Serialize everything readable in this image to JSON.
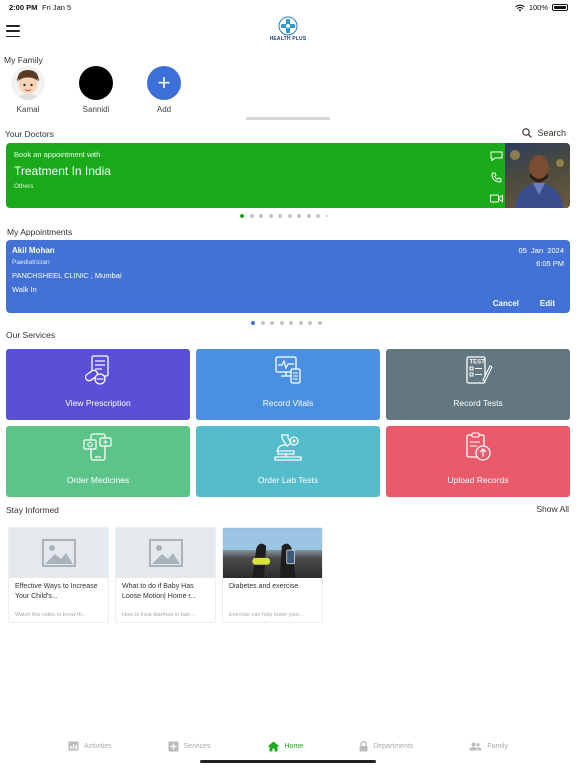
{
  "status_bar": {
    "time": "2:00 PM",
    "date": "Fri Jan 5",
    "battery": "100%"
  },
  "header": {
    "logo_text": "HEALTH PLUS"
  },
  "family": {
    "title": "My Family",
    "members": [
      {
        "name": "Kamal"
      },
      {
        "name": "Sannidi"
      }
    ],
    "add_label": "Add",
    "add_symbol": "+"
  },
  "doctors": {
    "title": "Your Doctors",
    "search_label": "Search",
    "card": {
      "pre": "Book an appointment with",
      "title": "Treatment In India",
      "sub": "Others"
    }
  },
  "appointments": {
    "title": "My Appointments",
    "card": {
      "doctor": "Akil Mohan",
      "specialty": "Paediatrician",
      "clinic": "PANCHSHEEL CLINIC , Mumbai",
      "type": "Walk In",
      "date": "05  Jan  2024",
      "time": "6:05 PM",
      "cancel_label": "Cancel",
      "edit_label": "Edit"
    }
  },
  "services": {
    "title": "Our Services",
    "items": [
      {
        "label": "View Prescription",
        "color": "#5b4fd8",
        "icon": "prescription-icon"
      },
      {
        "label": "Record Vitals",
        "color": "#4a90e2",
        "icon": "vitals-icon"
      },
      {
        "label": "Record Tests",
        "color": "#62777f",
        "icon": "tests-clipboard-icon"
      },
      {
        "label": "Order Medicines",
        "color": "#5cc489",
        "icon": "medicines-phone-icon"
      },
      {
        "label": "Order Lab Tests",
        "color": "#54bcca",
        "icon": "microscope-icon"
      },
      {
        "label": "Upload Records",
        "color": "#e95a6b",
        "icon": "upload-records-icon"
      }
    ]
  },
  "informed": {
    "title": "Stay Informed",
    "show_all": "Show All",
    "articles": [
      {
        "title": "Effective Ways to Increase Your Child's...",
        "snippet": "Watch this video to know th..."
      },
      {
        "title": "What to do if Baby Has Loose Motion| Home r...",
        "snippet": "How to treat diarrhea in bab..."
      },
      {
        "title": "Diabetes and exercise",
        "snippet": "Exercise can help lower your..."
      }
    ]
  },
  "nav": {
    "items": [
      {
        "label": "Activities",
        "icon": "activities-icon"
      },
      {
        "label": "Services",
        "icon": "services-plus-icon"
      },
      {
        "label": "Home",
        "icon": "home-icon"
      },
      {
        "label": "Departments",
        "icon": "lock-icon"
      },
      {
        "label": "Family",
        "icon": "family-icon"
      }
    ]
  },
  "colors": {
    "doctor_card": "#1aaa1a",
    "appointment_card": "#4372d6",
    "active_nav": "#1aaa1a"
  }
}
